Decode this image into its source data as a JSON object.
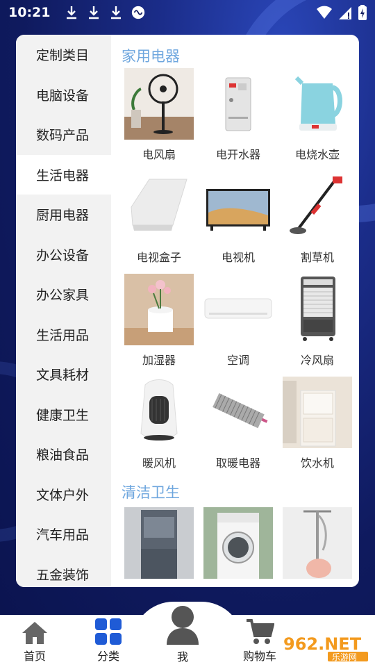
{
  "status_bar": {
    "time": "10:21"
  },
  "sidebar": {
    "items": [
      {
        "label": "定制类目"
      },
      {
        "label": "电脑设备"
      },
      {
        "label": "数码产品"
      },
      {
        "label": "生活电器"
      },
      {
        "label": "厨用电器"
      },
      {
        "label": "办公设备"
      },
      {
        "label": "办公家具"
      },
      {
        "label": "生活用品"
      },
      {
        "label": "文具耗材"
      },
      {
        "label": "健康卫生"
      },
      {
        "label": "粮油食品"
      },
      {
        "label": "文体户外"
      },
      {
        "label": "汽车用品"
      },
      {
        "label": "五金装饰"
      }
    ],
    "active_index": 3
  },
  "content": {
    "sections": [
      {
        "title": "家用电器",
        "items": [
          {
            "label": "电风扇",
            "icon": "fan-image"
          },
          {
            "label": "电开水器",
            "icon": "water-boiler-image"
          },
          {
            "label": "电烧水壶",
            "icon": "kettle-image"
          },
          {
            "label": "电视盒子",
            "icon": "tv-box-image"
          },
          {
            "label": "电视机",
            "icon": "tv-image"
          },
          {
            "label": "割草机",
            "icon": "lawn-mower-image"
          },
          {
            "label": "加湿器",
            "icon": "humidifier-image"
          },
          {
            "label": "空调",
            "icon": "air-conditioner-image"
          },
          {
            "label": "冷风扇",
            "icon": "air-cooler-image"
          },
          {
            "label": "暖风机",
            "icon": "heater-image"
          },
          {
            "label": "取暖电器",
            "icon": "radiator-image"
          },
          {
            "label": "饮水机",
            "icon": "water-dispenser-image"
          }
        ]
      },
      {
        "title": "清洁卫生",
        "items": [
          {
            "icon": "dehumidifier-image"
          },
          {
            "icon": "washing-machine-image"
          },
          {
            "icon": "garment-steamer-image"
          }
        ]
      }
    ]
  },
  "tabbar": {
    "tabs": [
      {
        "label": "首页",
        "icon": "home-icon"
      },
      {
        "label": "分类",
        "icon": "category-icon"
      },
      {
        "label": "我",
        "icon": "user-icon"
      },
      {
        "label": "购物车",
        "icon": "cart-icon"
      }
    ],
    "active_color": "#1f5bd6"
  },
  "watermark": {
    "text": "962.NET",
    "sub": "乐游网"
  }
}
